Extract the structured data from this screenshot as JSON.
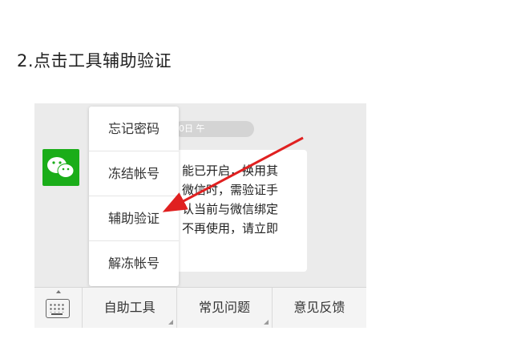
{
  "step_title": "2.点击工具辅助验证",
  "chat": {
    "time_label": "0日 午",
    "message_lines": [
      "能已开启，换用其",
      "微信时，需验证手",
      "认当前与微信绑定",
      "不再使用，请立即"
    ]
  },
  "popup_menu": {
    "items": [
      {
        "label": "忘记密码"
      },
      {
        "label": "冻结帐号"
      },
      {
        "label": "辅助验证"
      },
      {
        "label": "解冻帐号"
      }
    ]
  },
  "bottom_bar": {
    "keyboard_icon": "keyboard-icon",
    "tabs": [
      {
        "label": "自助工具"
      },
      {
        "label": "常见问题"
      },
      {
        "label": "意见反馈"
      }
    ]
  },
  "annotation": {
    "arrow_color": "#e02020",
    "points_to": "辅助验证"
  },
  "colors": {
    "wechat_green": "#1aad19",
    "chat_bg": "#ebebeb"
  }
}
